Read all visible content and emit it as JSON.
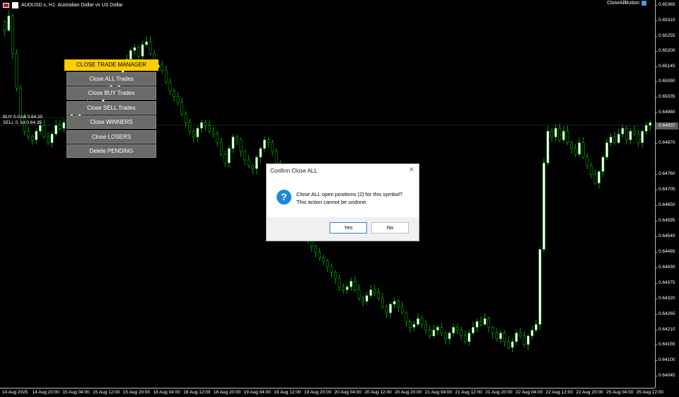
{
  "header": {
    "symbol_line": "AUDUSD.s, H1:  Australian Dollar vs US Dollar",
    "close_all_button": "CloseAllButton"
  },
  "price_axis": {
    "ticks": [
      "0.65365",
      "0.65310",
      "0.65255",
      "0.65200",
      "0.65145",
      "0.65090",
      "0.65035",
      "0.64980",
      "0.64925",
      "0.64870",
      "0.64760",
      "0.64705",
      "0.64650",
      "0.64595",
      "0.64540",
      "0.64485",
      "0.64430",
      "0.64375",
      "0.64320",
      "0.64265",
      "0.64210",
      "0.64155",
      "0.64100",
      "0.64045"
    ],
    "current_price": "0.64937"
  },
  "time_axis": {
    "ticks": [
      "14 Aug 2025",
      "14 Aug 20:00",
      "15 Aug 04:00",
      "15 Aug 12:00",
      "15 Aug 20:00",
      "18 Aug 04:00",
      "18 Aug 12:00",
      "18 Aug 20:00",
      "19 Aug 04:00",
      "19 Aug 12:00",
      "19 Aug 20:00",
      "20 Aug 04:00",
      "20 Aug 12:00",
      "20 Aug 20:00",
      "21 Aug 04:00",
      "21 Aug 12:00",
      "21 Aug 20:00",
      "22 Aug 04:00",
      "22 Aug 12:00",
      "22 Aug 20:00",
      "25 Aug 04:00",
      "25 Aug 12:00"
    ]
  },
  "trade_manager": {
    "title": "CLOSE TRADE MANAGER",
    "buttons": [
      "Close ALL Trades",
      "Close BUY Trades",
      "Close SELL Trades",
      "Close WINNERS",
      "Close LOSERS",
      "Delete PENDING"
    ]
  },
  "positions": {
    "buy_label": "BUY 0.0  lot 0.64.35",
    "sell_label": "SELL 0.  lot 0.64.35"
  },
  "dialog": {
    "title": "Confirm Close ALL",
    "message_line1": "Close ALL open positions (2) for this symbol?",
    "message_line2": "This action cannot be undone.",
    "yes": "Yes",
    "no": "No"
  },
  "colors": {
    "bull": "#ffffff",
    "bear": "#000000",
    "wick": "#00c800",
    "dialog_icon": "#1e88d8",
    "panel_title": "#ffcc00"
  },
  "chart_data": {
    "type": "candlestick",
    "ylim": [
      0.6402,
      0.65365
    ],
    "closes": [
      0.6526,
      0.6531,
      0.6518,
      0.6506,
      0.6496,
      0.6491,
      0.6489,
      0.6488,
      0.6491,
      0.6493,
      0.6489,
      0.6487,
      0.649,
      0.6493,
      0.6492,
      0.6494,
      0.6495,
      0.6498,
      0.6496,
      0.6497,
      0.65,
      0.6501,
      0.6499,
      0.65,
      0.65,
      0.6503,
      0.6506,
      0.6507,
      0.6505,
      0.6508,
      0.6513,
      0.6516,
      0.6519,
      0.652,
      0.6517,
      0.6521,
      0.6522,
      0.6518,
      0.6513,
      0.6514,
      0.6512,
      0.6508,
      0.6505,
      0.6503,
      0.6501,
      0.6497,
      0.6494,
      0.6491,
      0.6489,
      0.6492,
      0.6494,
      0.6493,
      0.6491,
      0.649,
      0.6487,
      0.6483,
      0.648,
      0.6485,
      0.6489,
      0.6488,
      0.6484,
      0.6481,
      0.6479,
      0.6478,
      0.6482,
      0.6485,
      0.6488,
      0.6487,
      0.6484,
      0.648,
      0.6477,
      0.6473,
      0.6469,
      0.6466,
      0.6463,
      0.6459,
      0.6456,
      0.6453,
      0.6451,
      0.6449,
      0.6447,
      0.6446,
      0.6444,
      0.6442,
      0.644,
      0.6437,
      0.6436,
      0.6437,
      0.6439,
      0.6436,
      0.6433,
      0.6432,
      0.6434,
      0.6436,
      0.6435,
      0.6433,
      0.643,
      0.6428,
      0.6431,
      0.6432,
      0.643,
      0.6428,
      0.6425,
      0.6423,
      0.6424,
      0.6426,
      0.6424,
      0.6422,
      0.642,
      0.6422,
      0.6423,
      0.6421,
      0.6419,
      0.6421,
      0.6423,
      0.6422,
      0.642,
      0.6418,
      0.6421,
      0.6423,
      0.6425,
      0.6424,
      0.6426,
      0.6423,
      0.6421,
      0.6419,
      0.6421,
      0.6418,
      0.6416,
      0.6418,
      0.6421,
      0.642,
      0.6417,
      0.642,
      0.6422,
      0.6424,
      0.645,
      0.648,
      0.6491,
      0.6489,
      0.6492,
      0.6488,
      0.6491,
      0.6487,
      0.6485,
      0.6483,
      0.6487,
      0.6482,
      0.6479,
      0.6476,
      0.6473,
      0.6477,
      0.6482,
      0.6487,
      0.6489,
      0.6487,
      0.649,
      0.6492,
      0.6488,
      0.6491,
      0.649,
      0.6487,
      0.6491,
      0.6493,
      0.6494
    ]
  }
}
